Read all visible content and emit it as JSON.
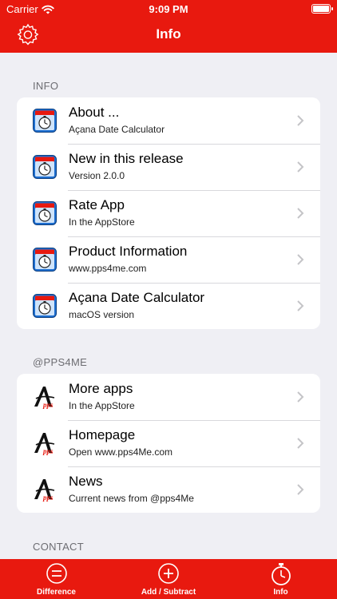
{
  "status": {
    "carrier": "Carrier",
    "time": "9:09 PM"
  },
  "nav": {
    "title": "Info"
  },
  "sections": [
    {
      "header": "INFO",
      "rows": [
        {
          "title": "About ...",
          "subtitle": "Açana Date Calculator",
          "icon": "calculator-app-icon"
        },
        {
          "title": "New in this release",
          "subtitle": "Version 2.0.0",
          "icon": "calculator-app-icon"
        },
        {
          "title": "Rate App",
          "subtitle": "In the AppStore",
          "icon": "calculator-app-icon"
        },
        {
          "title": "Product Information",
          "subtitle": "www.pps4me.com",
          "icon": "calculator-app-icon"
        },
        {
          "title": "Açana Date Calculator",
          "subtitle": "macOS version",
          "icon": "calculator-app-icon"
        }
      ]
    },
    {
      "header": "@PPS4ME",
      "rows": [
        {
          "title": "More apps",
          "subtitle": "In the AppStore",
          "icon": "pps-logo-icon"
        },
        {
          "title": "Homepage",
          "subtitle": "Open www.pps4Me.com",
          "icon": "pps-logo-icon"
        },
        {
          "title": "News",
          "subtitle": "Current news from @pps4Me",
          "icon": "pps-logo-icon"
        }
      ]
    },
    {
      "header": "CONTACT",
      "rows": []
    }
  ],
  "tabs": [
    {
      "label": "Difference",
      "icon": "difference-icon"
    },
    {
      "label": "Add / Subtract",
      "icon": "add-subtract-icon"
    },
    {
      "label": "Info",
      "icon": "stopwatch-icon",
      "selected": true
    }
  ],
  "colors": {
    "accent": "#e8190f",
    "background": "#efeff4"
  }
}
